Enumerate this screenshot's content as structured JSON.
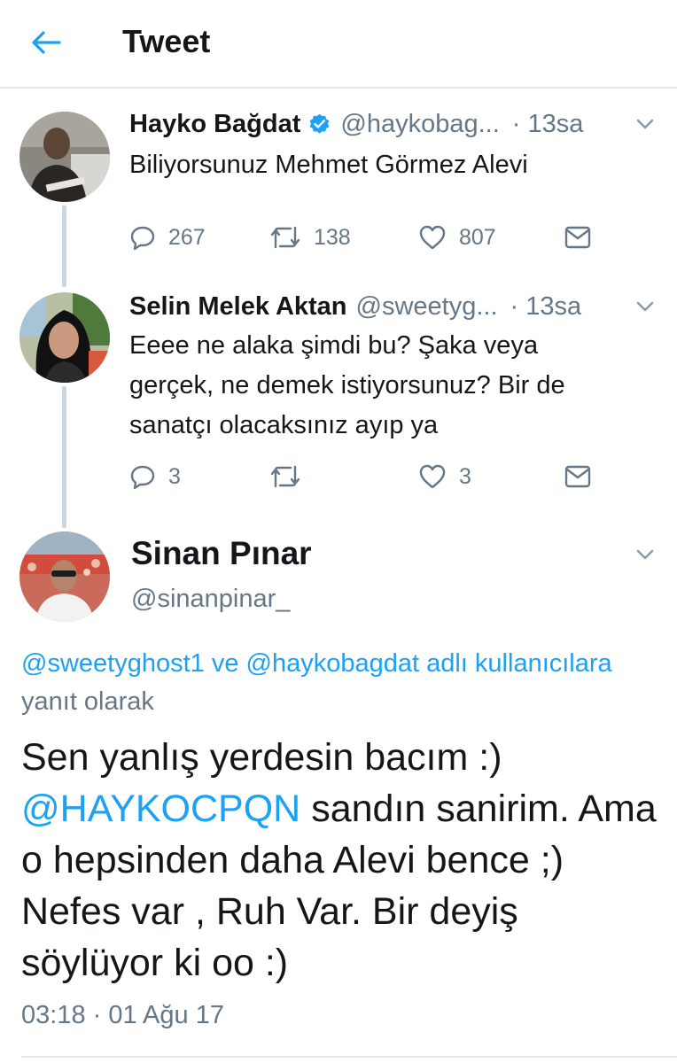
{
  "header": {
    "title": "Tweet",
    "back_icon": "arrow-left-icon",
    "accent": "#1da1f2"
  },
  "tweets": [
    {
      "name": "Hayko Bağdat",
      "verified": true,
      "handle": "@haykobag...",
      "time": "· 13sa",
      "text": "Biliyorsunuz Mehmet Görmez Alevi",
      "replies": "267",
      "retweets": "138",
      "likes": "807"
    },
    {
      "name": "Selin Melek Aktan",
      "verified": false,
      "handle": "@sweetyg...",
      "time": "· 13sa",
      "text": "Eeee ne alaka şimdi bu? Şaka veya gerçek, ne demek istiyorsunuz? Bir de sanatçı olacaksınız ayıp ya",
      "replies": "3",
      "retweets": "",
      "likes": "3"
    }
  ],
  "main_tweet": {
    "name": "Sinan Pınar",
    "handle": "@sinanpinar_",
    "reply_mention_1": "@sweetyghost1",
    "reply_connector": " ve ",
    "reply_mention_2": "@haykobagdat adlı kullanıcılara",
    "reply_suffix": " yanıt olarak",
    "text_line1": "Sen yanlış yerdesin bacım :)",
    "text_mention": "@HAYKOCPQN",
    "text_rest": " sandın sanirim. Ama o hepsinden daha Alevi bence ;) Nefes var , Ruh Var. Bir deyiş söylüyor ki oo :)",
    "timestamp": "03:18 · 01 Ağu 17"
  },
  "colors": {
    "text": "#14171a",
    "secondary": "#657786",
    "divider": "#e1e8ed",
    "link": "#1da1f2",
    "verified": "#1da1f2"
  }
}
